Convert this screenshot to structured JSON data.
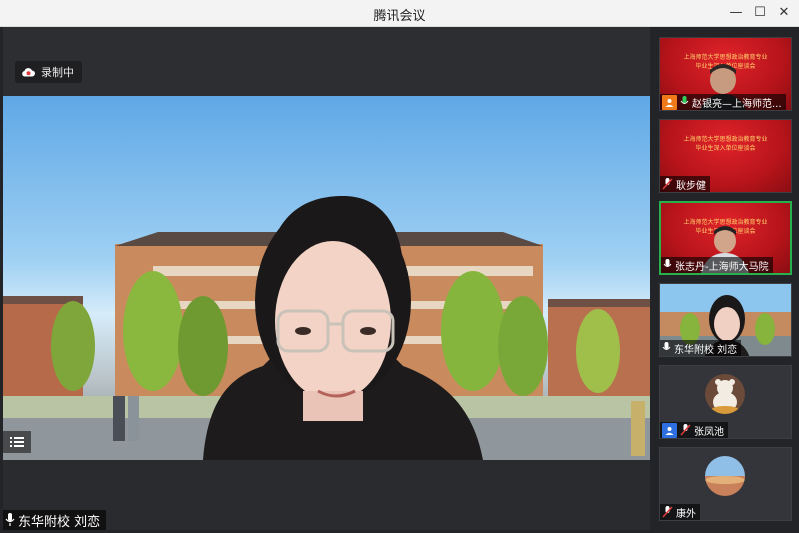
{
  "window": {
    "title": "腾讯会议"
  },
  "recording": {
    "label": "录制中"
  },
  "main_video": {
    "speaker_name": "东华附校 刘恋"
  },
  "banner": {
    "line1": "上海师范大学思想政治教育专业",
    "line2": "毕业生深入单位座谈会"
  },
  "participants": [
    {
      "name": "赵银亮—上海师范...",
      "mic": "on",
      "role_badge": "orange",
      "kind": "banner-person"
    },
    {
      "name": "耿步健",
      "mic": "muted",
      "kind": "banner"
    },
    {
      "name": "张志丹-上海师大马院",
      "mic": "on",
      "active": true,
      "kind": "banner-person"
    },
    {
      "name": "东华附校 刘恋",
      "mic": "on",
      "kind": "video"
    },
    {
      "name": "张凤池",
      "mic": "muted",
      "role_badge": "blue",
      "kind": "avatar-bear"
    },
    {
      "name": "康外",
      "mic": "muted",
      "kind": "avatar-sky"
    }
  ],
  "colors": {
    "active_border": "#27b04b",
    "recording_icon": "#e03a3a",
    "titlebar": "#f3f3f3"
  }
}
